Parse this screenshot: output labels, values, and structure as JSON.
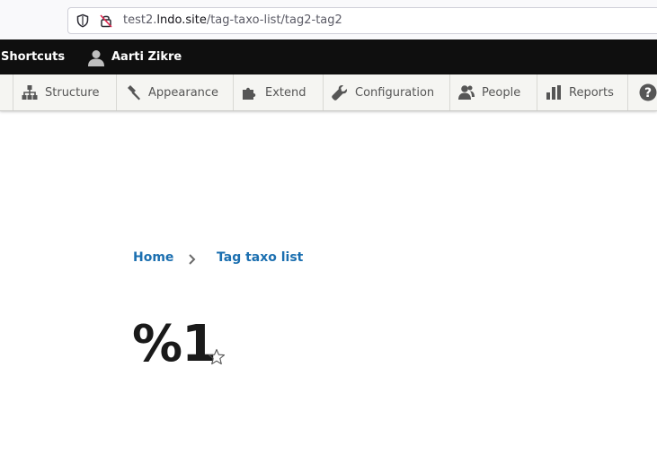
{
  "browser": {
    "url_host_prefix": "test2.",
    "url_host": "lndo.site",
    "url_path": "/tag-taxo-list/tag2-tag2"
  },
  "toolbar": {
    "shortcuts_label": "Shortcuts",
    "user_name": "Aarti Zikre"
  },
  "admin_menu": {
    "items": [
      {
        "label": "Structure",
        "icon": "structure-icon"
      },
      {
        "label": "Appearance",
        "icon": "appearance-icon"
      },
      {
        "label": "Extend",
        "icon": "extend-icon"
      },
      {
        "label": "Configuration",
        "icon": "configuration-icon"
      },
      {
        "label": "People",
        "icon": "people-icon"
      },
      {
        "label": "Reports",
        "icon": "reports-icon"
      },
      {
        "label": "",
        "icon": "help-icon"
      }
    ]
  },
  "breadcrumb": {
    "items": [
      {
        "label": "Home"
      },
      {
        "label": "Tag taxo list"
      }
    ]
  },
  "page": {
    "title": "%1"
  },
  "colors": {
    "link": "#1b6fb0",
    "toolbar_bg": "#0f0f0f",
    "tray_bg": "#f5f5f2",
    "title": "#1a1a1a"
  }
}
